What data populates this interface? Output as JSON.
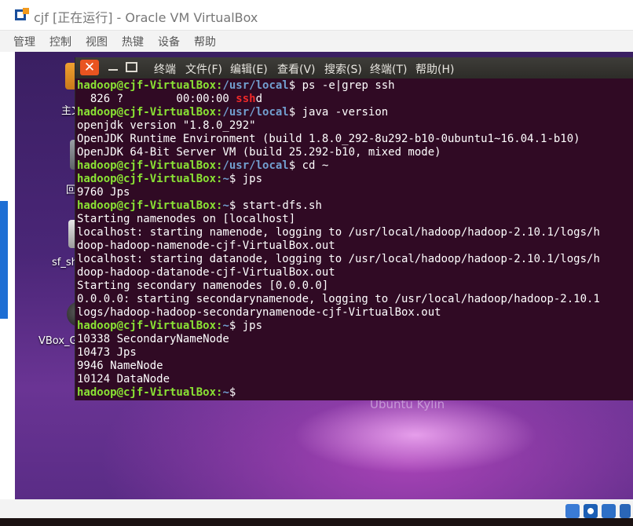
{
  "window": {
    "title": "cjf [正在运行] - Oracle VM VirtualBox",
    "menu": [
      "管理",
      "控制",
      "视图",
      "热键",
      "设备",
      "帮助"
    ]
  },
  "desktop": {
    "icons": [
      {
        "label": "主文"
      },
      {
        "label": "回"
      },
      {
        "label": "sf_sh"
      },
      {
        "label": "VBox_G"
      }
    ],
    "wallpaper_text": "Ubuntu Kylin"
  },
  "terminal": {
    "menu": [
      "终端",
      "文件(F)",
      "编辑(E)",
      "查看(V)",
      "搜索(S)",
      "终端(T)",
      "帮助(H)"
    ],
    "lines": [
      {
        "user": "hadoop@cjf-VirtualBox",
        "path": "/usr/local",
        "cmd": "ps -e|grep ssh"
      },
      {
        "pre": "  826 ?        00:00:00 ",
        "hl": "ssh",
        "post": "d"
      },
      {
        "user": "hadoop@cjf-VirtualBox",
        "path": "/usr/local",
        "cmd": "java -version"
      },
      {
        "text": "openjdk version \"1.8.0_292\""
      },
      {
        "text": "OpenJDK Runtime Environment (build 1.8.0_292-8u292-b10-0ubuntu1~16.04.1-b10)"
      },
      {
        "text": "OpenJDK 64-Bit Server VM (build 25.292-b10, mixed mode)"
      },
      {
        "user": "hadoop@cjf-VirtualBox",
        "path": "/usr/local",
        "cmd": "cd ~"
      },
      {
        "user": "hadoop@cjf-VirtualBox",
        "path": "~",
        "cmd": "jps"
      },
      {
        "text": "9760 Jps"
      },
      {
        "user": "hadoop@cjf-VirtualBox",
        "path": "~",
        "cmd": "start-dfs.sh"
      },
      {
        "text": "Starting namenodes on [localhost]"
      },
      {
        "text": "localhost: starting namenode, logging to /usr/local/hadoop/hadoop-2.10.1/logs/h"
      },
      {
        "text": "doop-hadoop-namenode-cjf-VirtualBox.out"
      },
      {
        "text": "localhost: starting datanode, logging to /usr/local/hadoop/hadoop-2.10.1/logs/h"
      },
      {
        "text": "doop-hadoop-datanode-cjf-VirtualBox.out"
      },
      {
        "text": "Starting secondary namenodes [0.0.0.0]"
      },
      {
        "text": "0.0.0.0: starting secondarynamenode, logging to /usr/local/hadoop/hadoop-2.10.1"
      },
      {
        "text": "logs/hadoop-hadoop-secondarynamenode-cjf-VirtualBox.out"
      },
      {
        "user": "hadoop@cjf-VirtualBox",
        "path": "~",
        "cmd": "jps"
      },
      {
        "text": "10338 SecondaryNameNode"
      },
      {
        "text": "10473 Jps"
      },
      {
        "text": "9946 NameNode"
      },
      {
        "text": "10124 DataNode"
      },
      {
        "user": "hadoop@cjf-VirtualBox",
        "path": "~",
        "cmd": ""
      }
    ]
  },
  "colors": {
    "terminal_bg": "#300a24",
    "prompt_user": "#8ae234",
    "prompt_path": "#729fcf",
    "grep_highlight": "#ef2929",
    "close_button": "#e95420"
  }
}
